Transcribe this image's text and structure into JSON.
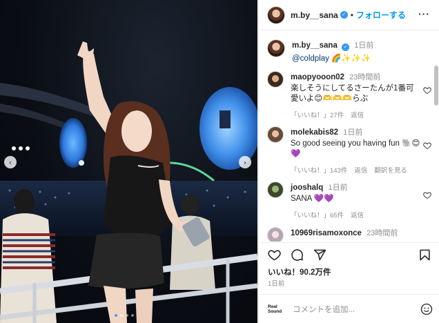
{
  "header": {
    "username": "m.by__sana",
    "separator": "•",
    "follow_label": "フォローする",
    "more_icon": "more-horizontal-icon",
    "verified_icon": "verified-badge-icon"
  },
  "caption": {
    "username": "m.by__sana",
    "time": "1日前",
    "text": "@coldplay 🌈✨✨✨"
  },
  "comments": [
    {
      "username": "maopyooon02",
      "time": "23時間前",
      "text": "楽しそうにしてるさーたんが1番可愛いよ😊🫶🫶🫶らぶ",
      "likes": "「いいね！」27件",
      "reply": "返信",
      "view_translation": ""
    },
    {
      "username": "molekabis82",
      "time": "1日前",
      "text": "So good seeing you having fun 🐘😊💜",
      "likes": "「いいね！」143件",
      "reply": "返信",
      "view_translation": "翻訳を見る"
    },
    {
      "username": "jooshalq",
      "time": "1日前",
      "text": "SANA 💜💜",
      "likes": "「いいね！」65件",
      "reply": "返信",
      "view_translation": ""
    },
    {
      "username": "10969risamoxonce",
      "time": "23時間前",
      "text": "",
      "likes": "",
      "reply": "",
      "view_translation": ""
    }
  ],
  "actions": {
    "likes_count": "いいね！90.2万件",
    "date": "1日前",
    "icons": [
      "heart-icon",
      "comment-icon",
      "share-icon",
      "bookmark-icon"
    ]
  },
  "add_comment": {
    "logo_line1": "Real",
    "logo_line2": "Sound",
    "placeholder": "コメントを追加...",
    "emoji_icon": "emoji-icon"
  },
  "carousel": {
    "slide_count": 4,
    "active_index": 0,
    "prev_icon": "chevron-left-icon",
    "next_icon": "chevron-right-icon"
  }
}
